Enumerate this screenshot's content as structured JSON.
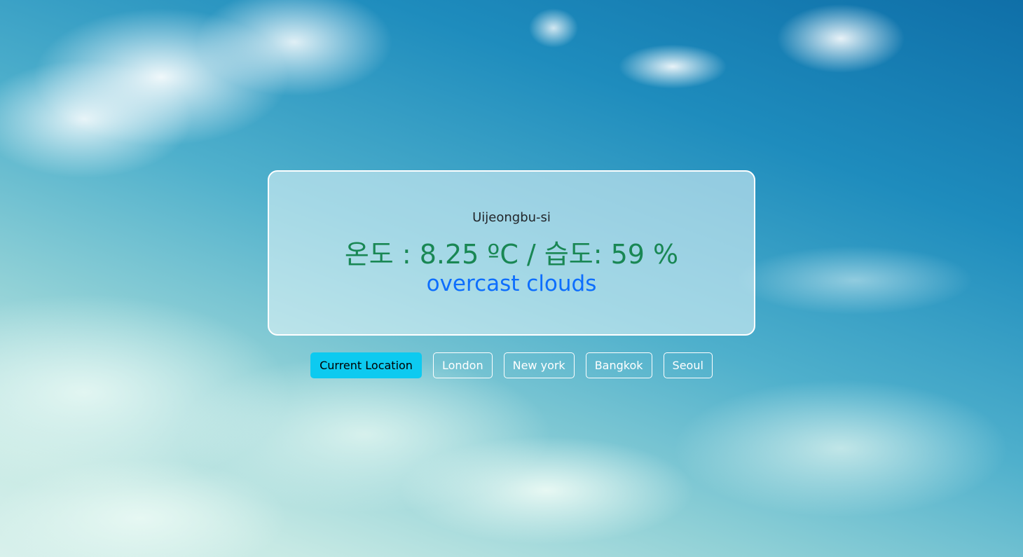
{
  "weather": {
    "city": "Uijeongbu-si",
    "temp_line": "온도 : 8.25 ºC / 습도: 59 %",
    "description": "overcast clouds"
  },
  "buttons": {
    "current_location": "Current Location",
    "cities": [
      "London",
      "New york",
      "Bangkok",
      "Seoul"
    ]
  },
  "colors": {
    "temp_text": "#198754",
    "description_text": "#0d6efd",
    "active_button": "#0dcaf0",
    "outline_button_border": "#ffffff"
  }
}
